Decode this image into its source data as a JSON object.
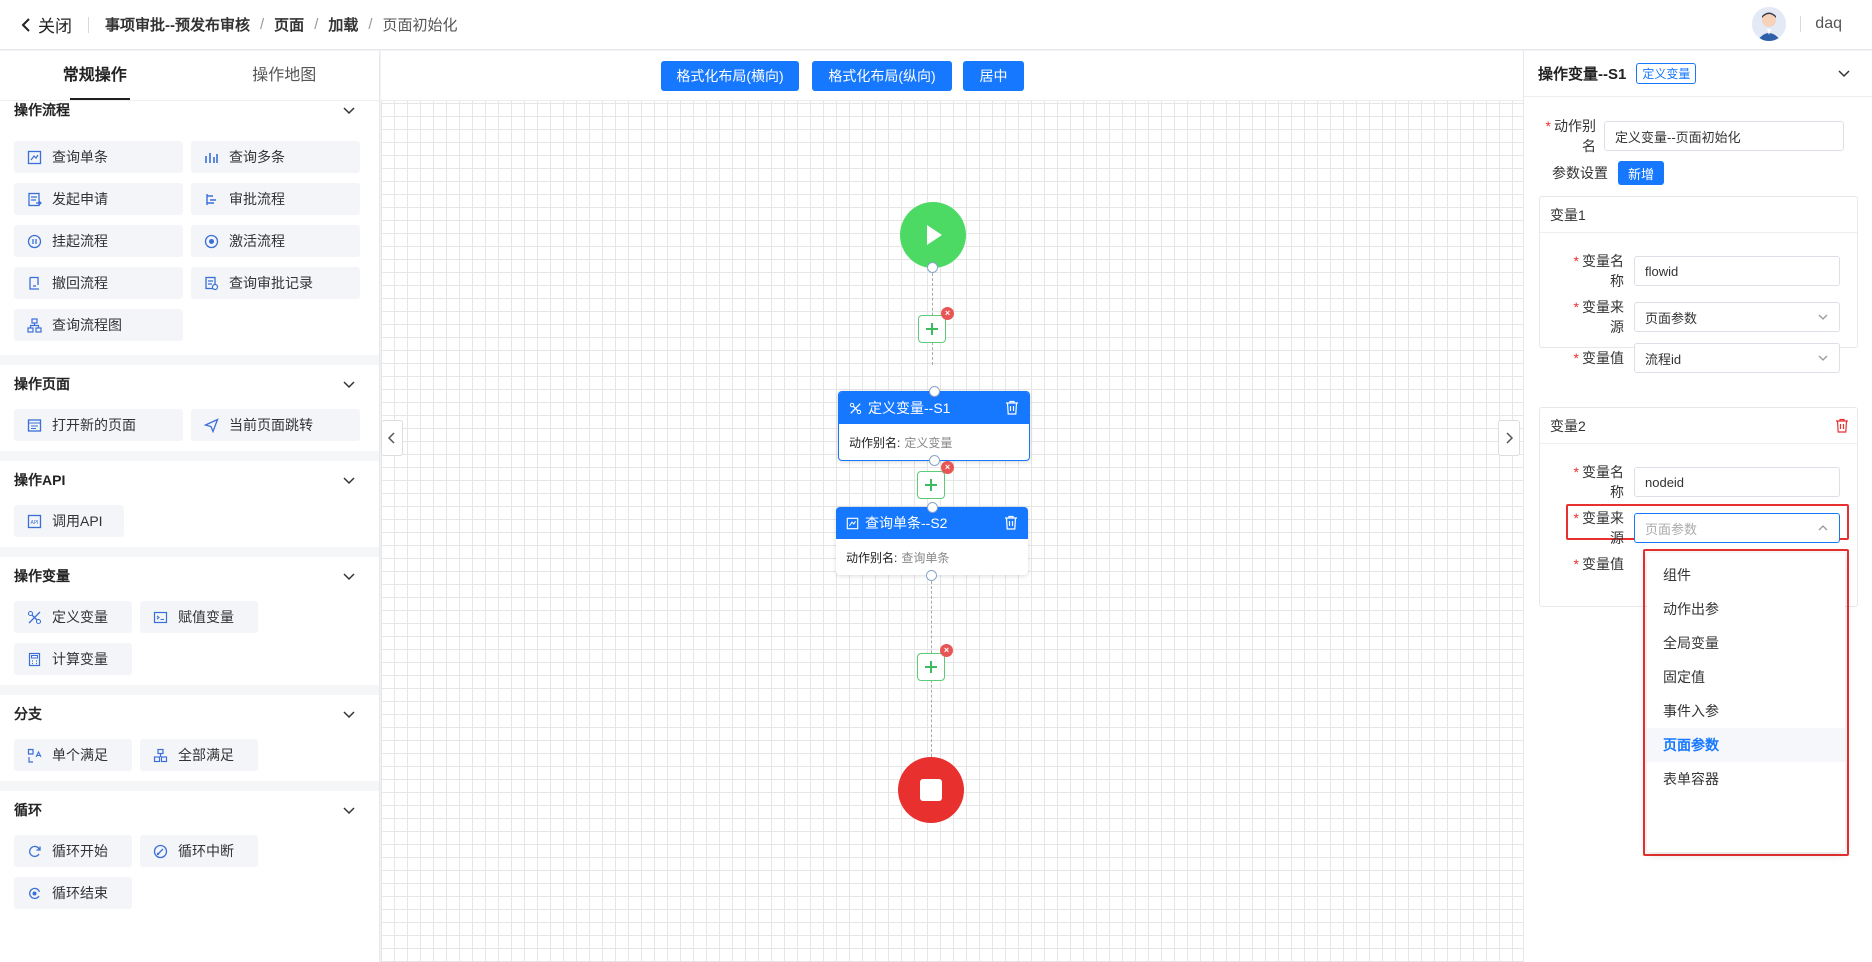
{
  "header": {
    "close_label": "关闭",
    "breadcrumb": [
      "事项审批--预发布审核",
      "页面",
      "加载",
      "页面初始化"
    ],
    "username": "daq"
  },
  "left": {
    "tabs": [
      "常规操作",
      "操作地图"
    ],
    "groups": [
      {
        "title": "操作流程",
        "items": [
          "查询单条",
          "查询多条",
          "发起申请",
          "审批流程",
          "挂起流程",
          "激活流程",
          "撤回流程",
          "查询审批记录",
          "查询流程图"
        ]
      },
      {
        "title": "操作页面",
        "items": [
          "打开新的页面",
          "当前页面跳转"
        ]
      },
      {
        "title": "操作API",
        "items": [
          "调用API"
        ]
      },
      {
        "title": "操作变量",
        "items": [
          "定义变量",
          "赋值变量",
          "计算变量"
        ]
      },
      {
        "title": "分支",
        "items": [
          "单个满足",
          "全部满足"
        ]
      },
      {
        "title": "循环",
        "items": [
          "循环开始",
          "循环中断",
          "循环结束"
        ]
      }
    ]
  },
  "canvas": {
    "buttons": [
      "格式化布局(横向)",
      "格式化布局(纵向)",
      "居中"
    ],
    "nodes": [
      {
        "title": "定义变量--S1",
        "alias_label": "动作别名:",
        "alias": "定义变量"
      },
      {
        "title": "查询单条--S2",
        "alias_label": "动作别名:",
        "alias": "查询单条"
      }
    ]
  },
  "right": {
    "title": "操作变量--S1",
    "tag": "定义变量",
    "alias_label": "动作别名",
    "alias_value": "定义变量--页面初始化",
    "params_label": "参数设置",
    "new_label": "新增",
    "vars": [
      {
        "title": "变量1",
        "name_label": "变量名称",
        "name": "flowid",
        "source_label": "变量来源",
        "source": "页面参数",
        "value_label": "变量值",
        "value": "流程id"
      },
      {
        "title": "变量2",
        "name_label": "变量名称",
        "name": "nodeid",
        "source_label": "变量来源",
        "source": "页面参数",
        "value_label": "变量值"
      }
    ],
    "dropdown": [
      "组件",
      "动作出参",
      "全局变量",
      "固定值",
      "事件入参",
      "页面参数",
      "表单容器"
    ],
    "dropdown_selected": "页面参数"
  },
  "colors": {
    "primary": "#1677ff",
    "start": "#4cd964",
    "end": "#e8302f"
  }
}
